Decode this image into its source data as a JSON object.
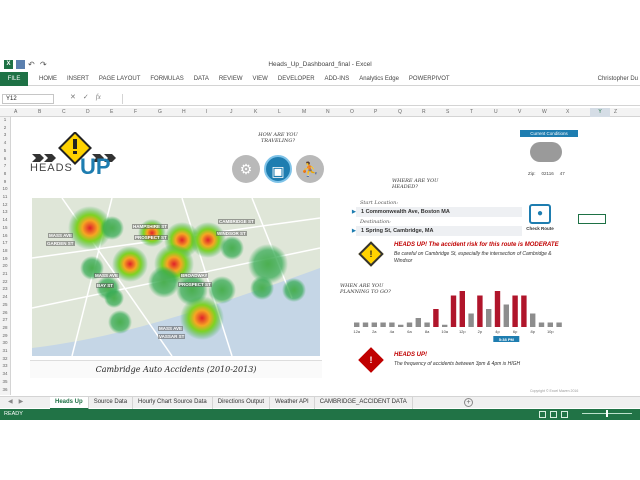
{
  "window": {
    "title": "Heads_Up_Dashboard_final - Excel",
    "user": "Christopher Du"
  },
  "ribbon": {
    "file_label": "FILE",
    "tabs": [
      "HOME",
      "INSERT",
      "PAGE LAYOUT",
      "FORMULAS",
      "DATA",
      "REVIEW",
      "VIEW",
      "DEVELOPER",
      "ADD-INS",
      "Analytics Edge",
      "POWERPIVOT"
    ]
  },
  "formula_bar": {
    "name_box": "Y12",
    "fx_label": "fx",
    "value": ""
  },
  "columns": [
    "A",
    "B",
    "C",
    "D",
    "E",
    "F",
    "G",
    "H",
    "I",
    "J",
    "K",
    "L",
    "M",
    "N",
    "O",
    "P",
    "Q",
    "R",
    "S",
    "T",
    "U",
    "V",
    "W",
    "X",
    "Y",
    "Z"
  ],
  "selected_column": "Y",
  "rows": [
    "1",
    "2",
    "3",
    "4",
    "5",
    "6",
    "7",
    "8",
    "9",
    "10",
    "11",
    "12",
    "13",
    "14",
    "15",
    "16",
    "17",
    "18",
    "19",
    "20",
    "21",
    "22",
    "23",
    "24",
    "25",
    "26",
    "27",
    "28",
    "29",
    "30",
    "31",
    "32",
    "33",
    "34",
    "35",
    "36"
  ],
  "dashboard": {
    "logo_heads": "HEADS",
    "logo_up": "UP",
    "modes_label": "HOW ARE YOU TRAVELING?",
    "modes": [
      {
        "name": "bike",
        "glyph": "⚲",
        "active": false
      },
      {
        "name": "car",
        "glyph": "▣",
        "active": true
      },
      {
        "name": "walk",
        "glyph": "⚇",
        "active": false
      }
    ],
    "where_label": "WHERE ARE YOU HEADED?",
    "start_label": "Start Location:",
    "start_value": "1 Commonwealth Ave, Boston MA",
    "dest_label": "Destination:",
    "dest_value": "1 Spring St, Cambridge, MA",
    "check_route": "Check Route",
    "route_warning_head": "HEADS UP! The accident risk for this route is MODERATE",
    "route_warning_body": "Be careful on Cambridge St, especially the intersection of Cambridge & Windsor",
    "plan_label": "WHEN ARE YOU PLANNING TO GO?",
    "time_marker": "5:38 PM",
    "time_warning_head": "HEADS UP!",
    "time_warning_body": "The frequency of accidents between 3pm & 4pm is HIGH",
    "map_caption": "Cambridge Auto Accidents (2010-2013)",
    "map_labels": [
      "HAMPSHIRE ST",
      "CAMBRIDGE ST",
      "MASS AVE",
      "GARDEN ST",
      "PROSPECT ST",
      "WINDSOR ST",
      "BROADWAY",
      "PROSPECT ST",
      "MASS AVE",
      "BAY ST",
      "MASS AVE",
      "VASSAR ST"
    ],
    "conditions_header": "Current Conditions",
    "zip_label": "Zip:",
    "zip_value": "02116",
    "temp_value": "47",
    "copyright": "Copyright © Excel Maven 2016"
  },
  "chart_data": {
    "type": "bar",
    "categories": [
      "12a",
      "1a",
      "2a",
      "3a",
      "4a",
      "5a",
      "6a",
      "7a",
      "8a",
      "9a",
      "10a",
      "11a",
      "12p",
      "1p",
      "2p",
      "3p",
      "4p",
      "5p",
      "6p",
      "7p",
      "8p",
      "9p",
      "10p",
      "11p"
    ],
    "x_tick_labels": [
      "12a",
      "2a",
      "4a",
      "6a",
      "8a",
      "10a",
      "12p",
      "2p",
      "4p",
      "6p",
      "8p",
      "10p"
    ],
    "values": [
      1,
      1,
      1,
      1,
      1,
      0.5,
      1,
      2,
      1,
      4,
      0.5,
      7,
      8,
      3,
      7,
      4,
      8,
      5,
      7,
      7,
      3,
      1,
      1,
      1
    ],
    "highlight_categories": [
      "9a",
      "11a",
      "12p",
      "2p",
      "4p",
      "6p",
      "7p"
    ],
    "colors": {
      "normal": "#8d8d8d",
      "highlight": "#b0152b"
    },
    "ylim": [
      0,
      8
    ]
  },
  "sheet_tabs": [
    "Heads Up",
    "Source Data",
    "Hourly Chart Source Data",
    "Directions Output",
    "Weather API",
    "CAMBRIDGE_ACCIDENT DATA"
  ],
  "active_sheet": "Heads Up",
  "status": {
    "ready": "READY"
  }
}
